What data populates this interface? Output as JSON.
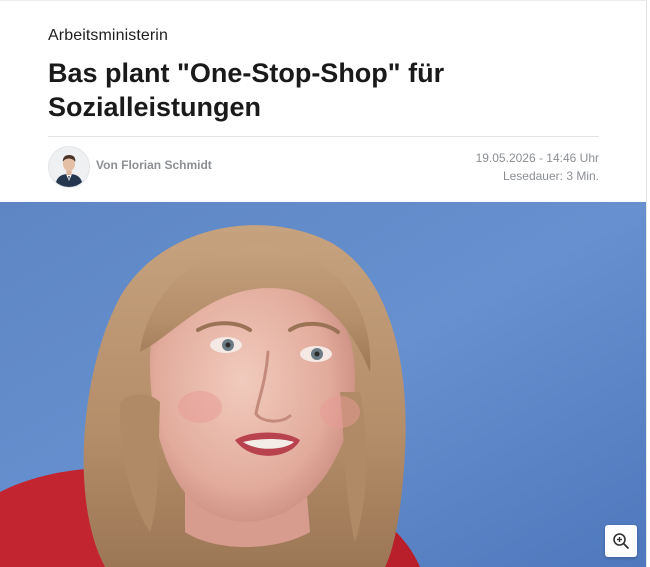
{
  "article": {
    "kicker": "Arbeitsministerin",
    "headline": "Bas plant \"One-Stop-Shop\" für Sozialleistungen"
  },
  "byline": {
    "author": "Von Florian Schmidt",
    "date": "19.05.2026 - 14:46 Uhr",
    "read_time": "Lesedauer: 3 Min."
  },
  "media": {
    "hero_icon": "portrait-photo",
    "zoom_icon": "zoom-in-icon"
  },
  "colors": {
    "headline": "#1a1a1a",
    "meta": "#8b8f94",
    "photo_background": "#5b86c8"
  }
}
